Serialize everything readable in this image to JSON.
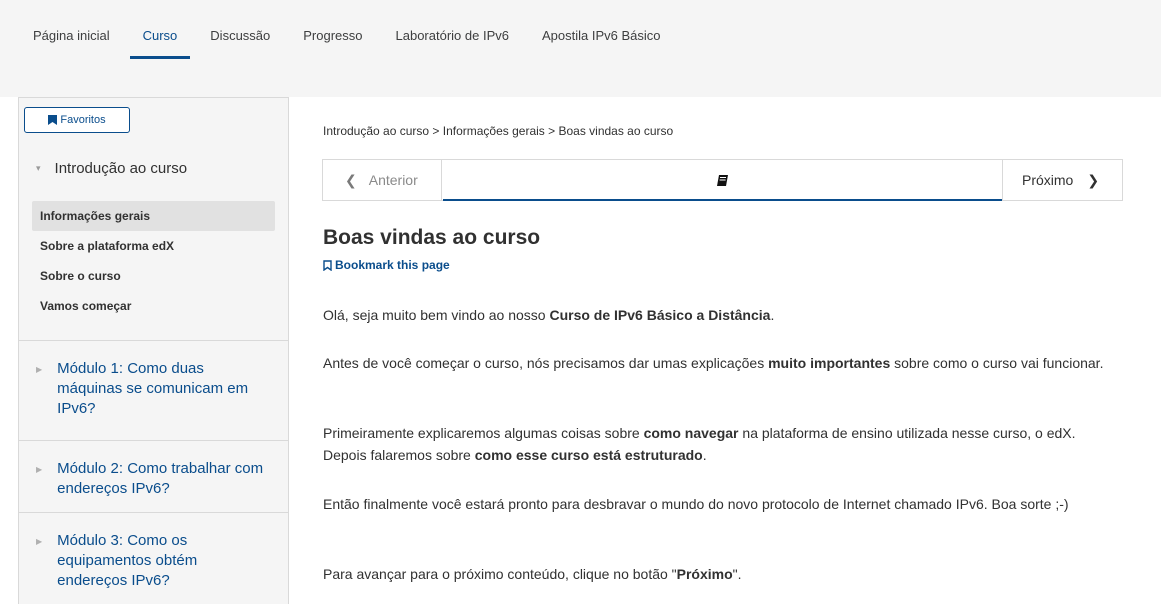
{
  "tabs": [
    {
      "label": "Página inicial",
      "active": false
    },
    {
      "label": "Curso",
      "active": true
    },
    {
      "label": "Discussão",
      "active": false
    },
    {
      "label": "Progresso",
      "active": false
    },
    {
      "label": "Laboratório de IPv6",
      "active": false
    },
    {
      "label": "Apostila IPv6 Básico",
      "active": false
    }
  ],
  "sidebar": {
    "favorites_label": "Favoritos",
    "open_chapter": "Introdução ao curso",
    "sections": [
      {
        "label": "Informações gerais",
        "active": true
      },
      {
        "label": "Sobre a plataforma edX",
        "active": false
      },
      {
        "label": "Sobre o curso",
        "active": false
      },
      {
        "label": "Vamos começar",
        "active": false
      }
    ],
    "chapters": [
      {
        "label": "Módulo 1: Como duas máquinas se comunicam em IPv6?"
      },
      {
        "label": "Módulo 2: Como trabalhar com endereços IPv6?"
      },
      {
        "label": "Módulo 3: Como os equipamentos obtém endereços IPv6?"
      }
    ]
  },
  "breadcrumb": "Introdução ao curso > Informações gerais > Boas vindas ao curso",
  "sequence": {
    "prev_label": "Anterior",
    "next_label": "Próximo",
    "current_icon": "book-icon"
  },
  "page": {
    "title": "Boas vindas ao curso",
    "bookmark_label": "Bookmark this page",
    "paragraphs": {
      "p1_a": "Olá, seja muito bem vindo ao nosso ",
      "p1_b": "Curso de IPv6 Básico a Distância",
      "p1_c": ".",
      "p2_a": "Antes de você começar o curso, nós precisamos dar umas explicações ",
      "p2_b": "muito importantes",
      "p2_c": " sobre como o curso vai funcionar.",
      "p3_a": "Primeiramente explicaremos algumas coisas sobre ",
      "p3_b": "como navegar",
      "p3_c": " na plataforma de ensino utilizada nesse curso, o edX. Depois falaremos sobre ",
      "p3_d": "como esse curso está estruturado",
      "p3_e": ".",
      "p4": "Então finalmente você estará pronto para desbravar o mundo do novo protocolo de Internet chamado IPv6. Boa sorte ;-)",
      "p5_a": "Para avançar para o próximo conteúdo, clique no botão \"",
      "p5_b": "Próximo",
      "p5_c": "\"."
    }
  },
  "colors": {
    "accent": "#0a4d8c",
    "sidebar_bg": "#f5f5f5",
    "active_section_bg": "#e1e1e1"
  }
}
